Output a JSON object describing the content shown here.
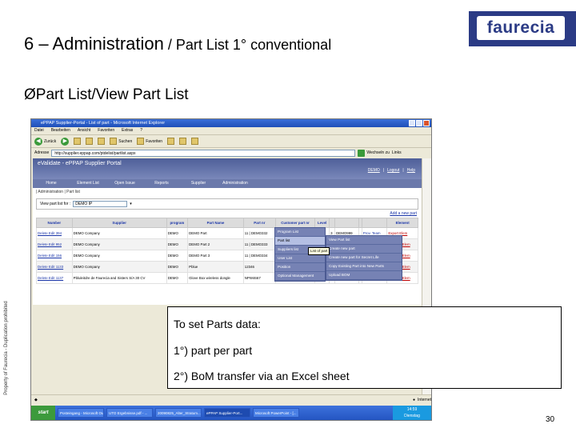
{
  "slide": {
    "title_main": "6 – Administration",
    "title_sub": " / Part List 1° conventional",
    "bullet": "ØPart List/View Part List",
    "logo": "faurecia",
    "side_note": "Property of Faurecia - Duplication prohibited",
    "page_number": "30"
  },
  "callout": {
    "line1": "To set Parts data:",
    "line2": "1°) part per part",
    "line3": "2°) BoM transfer via an Excel sheet"
  },
  "browser": {
    "window_title": "ePPAP Supplier-Portal - List of part - Microsoft Internet Explorer",
    "menu": [
      "Datei",
      "Bearbeiten",
      "Ansicht",
      "Favoriten",
      "Extras",
      "?"
    ],
    "toolbar": {
      "back": "Zurück",
      "search": "Suchen",
      "favorites": "Favoriten"
    },
    "address_label": "Adresse",
    "address": "http://supplier.eppap.com/ptdelist/partlist.aspx",
    "go_label": "Wechseln zu",
    "links_label": "Links"
  },
  "portal": {
    "title": "eValidate - ePPAP Supplier Portal",
    "header_links": [
      "DEMO",
      "Logout",
      "Help"
    ],
    "nav": [
      "Home",
      "Element List",
      "Open Issue",
      "Reports",
      "Supplier",
      "Administration"
    ],
    "breadcrumb": "| Administration | Part list",
    "view_label": "View part list for :",
    "view_value": "DEMO IP",
    "add_new": "Add a new part",
    "admin_menu": [
      "Program List",
      "Part list",
      "Suppliers list",
      "User List",
      "Position",
      "Optional Management"
    ],
    "admin_menu_highlight": 1,
    "part_submenu": [
      "View Part list",
      "Create new part",
      "Create new part for Secret Life",
      "Copy Existing Part into New Parts",
      "Upload BOM"
    ],
    "tooltip": "List of part",
    "table": {
      "headers": [
        "Number",
        "Supplier",
        "program",
        "Part Name",
        "Part nr",
        "Customer part nr",
        "Level",
        "",
        "",
        "",
        "",
        "Element"
      ],
      "rows": [
        [
          "Delete Edit 394",
          "DEMO Company",
          "DEMO",
          "DEMO Part",
          "11 | DEMO332",
          "11 | 11A66668",
          "3",
          "3",
          "DEMO999",
          "",
          "Prov. Team",
          "Export Elem"
        ],
        [
          "Delete Edit 952",
          "DEMO Company",
          "DEMO",
          "DEMO Part 2",
          "11 | DEMO333",
          "11 | 11A66669",
          "3",
          "3",
          "DEMO999",
          "",
          "Prov. Team",
          "Element Elem"
        ],
        [
          "Delete Edit 156",
          "DEMO Company",
          "DEMO",
          "DEMO Part 3",
          "11 | DEMO334",
          "11 | 11A66667",
          "3",
          "3",
          "DEMO999",
          "",
          "Prov. Team",
          "Element Elem"
        ],
        [
          "Delete Edit 1133",
          "DEMO Company",
          "DEMO",
          "Pblue",
          "12346",
          "12346",
          "1",
          "2",
          "12346",
          "",
          "Prov. Team",
          "Element Elem"
        ],
        [
          "Delete Edit 1137",
          "Pbluleitdre de Faurecia and Sisters S/A 30 CV",
          "DEMO",
          "Glove Box wireless dongle",
          "NPW4667",
          "",
          "",
          "",
          "",
          "",
          "Prov. Team",
          "Element Elem"
        ]
      ]
    }
  },
  "statusbar": {
    "zone": "Internet"
  },
  "taskbar": {
    "start": "start",
    "items": [
      "Posteingang - Microsoft Outlook",
      "UTO Ergebnisse.pdf - ...",
      "20090825_Alter_Stratum...",
      "ePPAP Supplier-Port...",
      "Microsoft PowerPoint - [..."
    ],
    "active_index": 3,
    "clock": "14:59",
    "day": "Dienstag"
  }
}
